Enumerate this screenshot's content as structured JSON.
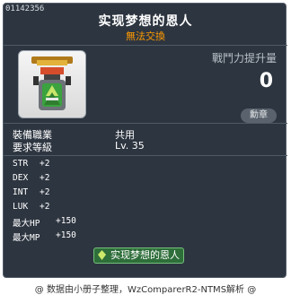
{
  "item": {
    "id": "01142356",
    "name": "实现梦想的恩人",
    "trade_status": "無法交換"
  },
  "combat": {
    "label": "戰鬥力提升量",
    "value": "0"
  },
  "medal_button": "勳章",
  "requirements": [
    {
      "label": "裝備職業",
      "value": "共用"
    },
    {
      "label": "要求等級",
      "value": "Lv. 35"
    }
  ],
  "stats": [
    {
      "label": "STR",
      "value": "+2"
    },
    {
      "label": "DEX",
      "value": "+2"
    },
    {
      "label": "INT",
      "value": "+2"
    },
    {
      "label": "LUK",
      "value": "+2"
    },
    {
      "label": "最大HP",
      "value": "+150"
    },
    {
      "label": "最大MP",
      "value": "+150"
    }
  ],
  "set_tag": "实现梦想的恩人",
  "footer": "@ 数据由小册子整理，WzComparerR2-NTMS解析 @",
  "colors": {
    "background": "#2d3540",
    "title": "#ffffff",
    "subtitle": "#ff9a00",
    "tag_bg": "#2e6e3a"
  },
  "icons": {
    "item": "medal-icon",
    "set_tag": "green-medal-icon"
  }
}
